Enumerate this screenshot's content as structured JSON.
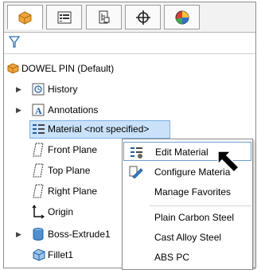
{
  "tabs": [
    {
      "icon": "feature-manager-icon",
      "active": true
    },
    {
      "icon": "property-manager-icon",
      "active": false
    },
    {
      "icon": "configuration-manager-icon",
      "active": false
    },
    {
      "icon": "dimxpert-manager-icon",
      "active": false
    },
    {
      "icon": "display-manager-icon",
      "active": false
    }
  ],
  "filter_icon": "filter-icon",
  "tree": {
    "root": "DOWEL PIN  (Default)",
    "items": [
      {
        "label": "History",
        "icon": "history-icon",
        "expandable": true
      },
      {
        "label": "Annotations",
        "icon": "annotations-icon",
        "expandable": true
      },
      {
        "label": "Material <not specified>",
        "icon": "material-icon",
        "expandable": false,
        "selected": true
      },
      {
        "label": "Front Plane",
        "icon": "plane-icon",
        "expandable": false
      },
      {
        "label": "Top Plane",
        "icon": "plane-icon",
        "expandable": false
      },
      {
        "label": "Right Plane",
        "icon": "plane-icon",
        "expandable": false
      },
      {
        "label": "Origin",
        "icon": "origin-icon",
        "expandable": false
      },
      {
        "label": "Boss-Extrude1",
        "icon": "extrude-icon",
        "expandable": true
      },
      {
        "label": "Fillet1",
        "icon": "fillet-icon",
        "expandable": false
      }
    ]
  },
  "context_menu": {
    "items": [
      {
        "label": "Edit Material",
        "icon": "edit-material-icon"
      },
      {
        "label": "Configure Materia",
        "icon": "configure-material-icon"
      },
      {
        "label": "Manage Favorites",
        "icon": ""
      },
      {
        "label": "Plain Carbon Steel",
        "icon": ""
      },
      {
        "label": "Cast Alloy Steel",
        "icon": ""
      },
      {
        "label": "ABS PC",
        "icon": ""
      }
    ]
  },
  "colors": {
    "selection": "#c9e2fa",
    "selection_border": "#7fb0e3",
    "part_icon": "#f2a43a"
  }
}
